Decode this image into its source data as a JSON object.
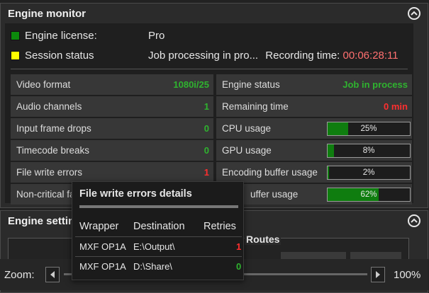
{
  "engine_monitor": {
    "title": "Engine monitor",
    "license": {
      "label": "Engine license:",
      "value": "Pro",
      "color": "#0c8a0c"
    },
    "session": {
      "label": "Session status",
      "value": "Job processing in pro...",
      "recording_label": "Recording time:",
      "recording_time": "00:06:28:11",
      "color": "#ffff00"
    },
    "left_metrics": [
      {
        "label": "Video format",
        "value": "1080i/25"
      },
      {
        "label": "Audio channels",
        "value": "1"
      },
      {
        "label": "Input frame drops",
        "value": "0"
      },
      {
        "label": "Timecode breaks",
        "value": "0"
      },
      {
        "label": "File write errors",
        "value": "1"
      },
      {
        "label": "Non-critical fa",
        "value": ""
      }
    ],
    "right_metrics": [
      {
        "label": "Engine status",
        "value": "Job in process"
      },
      {
        "label": "Remaining time",
        "value": "0 min"
      },
      {
        "label": "CPU usage",
        "value": "25%",
        "fill": 0.25
      },
      {
        "label": "GPU usage",
        "value": "8%",
        "fill": 0.08
      },
      {
        "label": "Encoding buffer usage",
        "value": "2%",
        "fill": 0.02
      },
      {
        "label": "uffer usage",
        "value": "62%",
        "fill": 0.62
      }
    ]
  },
  "engine_settings": {
    "title": "Engine settin",
    "routes_label": "Routes"
  },
  "zoom": {
    "label": "Zoom:",
    "value": "100%"
  },
  "popup": {
    "title": "File write errors details",
    "headers": {
      "wrapper": "Wrapper",
      "destination": "Destination",
      "retries": "Retries"
    },
    "rows": [
      {
        "wrapper": "MXF OP1A",
        "destination": "E:\\Output\\",
        "retries": "1"
      },
      {
        "wrapper": "MXF OP1A",
        "destination": "D:\\Share\\",
        "retries": "0"
      }
    ]
  }
}
